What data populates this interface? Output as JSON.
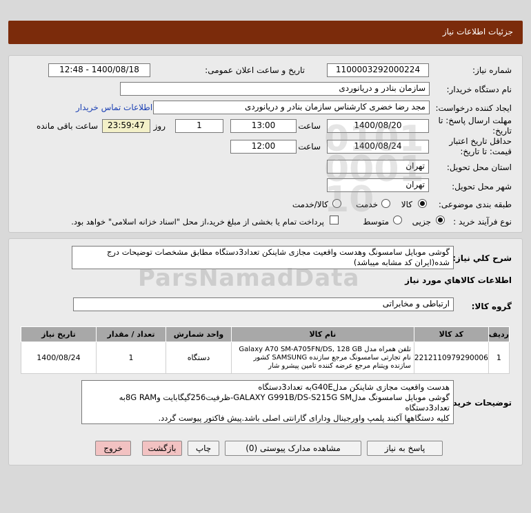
{
  "header": {
    "title": "جزئیات اطلاعات نیاز"
  },
  "form": {
    "need_number_label": "شماره نیاز:",
    "need_number": "1100003292000224",
    "announce_label": "تاریخ و ساعت اعلان عمومی:",
    "announce_value": "1400/08/18 - 12:48",
    "buyer_org_label": "نام دستگاه خریدار:",
    "buyer_org": "سازمان بنادر و دریانوردی",
    "requester_label": "ایجاد کننده درخواست:",
    "requester": "مجد رضا خضری کارشناس سازمان بنادر و دریانوردی",
    "contact_link": "اطلاعات تماس خریدار",
    "deadline_label_1": "مهلت ارسال پاسخ: تا",
    "deadline_label_2": "تاریخ:",
    "deadline_date": "1400/08/20",
    "hour_label": "ساعت",
    "deadline_hour": "13:00",
    "deadline_days": "1",
    "days_label": "روز و",
    "remaining_time": "23:59:47",
    "remaining_label": "ساعت باقی مانده",
    "validity_label_1": "حداقل تاریخ اعتبار",
    "validity_label_2": "قیمت: تا تاریخ:",
    "validity_date": "1400/08/24",
    "validity_hour_label": "ساعت",
    "validity_hour": "12:00",
    "province_label": "استان محل تحویل:",
    "province": "تهران",
    "city_label": "شهر محل تحویل:",
    "city": "تهران",
    "category_label": "طبقه بندی موضوعی:",
    "category_options": [
      "کالا",
      "خدمت",
      "کالا/خدمت"
    ],
    "category_selected": 0,
    "process_label": "نوع فرآیند خرید :",
    "process_options": [
      "جزیی",
      "متوسط"
    ],
    "process_selected": 0,
    "payment_note": "پرداخت تمام یا بخشی از مبلغ خرید،از محل \"اسناد خزانه اسلامی\" خواهد بود."
  },
  "summary": {
    "label": "شرح کلي نياز:",
    "text": "گوشی موبایل سامسونگ وهدست واقعیت مجازی شاینکن تعداد3دستگاه مطابق مشخصات توضیحات درج شده(ایران کد مشابه میباشد)"
  },
  "goods_section": {
    "title": "اطلاعات کالاهاي مورد نياز",
    "group_label": "گروه کالا:",
    "group_value": "ارتباطی و مخابراتی"
  },
  "table": {
    "headers": [
      "ردیف",
      "کد کالا",
      "نام کالا",
      "واحد شمارش",
      "تعداد / مقدار",
      "تاریخ نیاز"
    ],
    "rows": [
      {
        "index": "1",
        "code": "2212110979290006",
        "name": "تلفن همراه مدل Galaxy A70 SM-A705FN/DS, 128 GB نام تجارتی سامسونگ مرجع سازنده SAMSUNG کشور سازنده ویتنام مرجع عرضه کننده تامین پیشرو شار",
        "unit": "دستگاه",
        "qty": "1",
        "date": "1400/08/24"
      }
    ]
  },
  "buyer_notes": {
    "label": "توضیحات خریدار:",
    "lines": [
      "هدست واقعیت مجازی شاینکن مدلG40Eبه تعداد3دستگاه",
      "گوشی موبایل سامسونگ مدلGALAXY G991B/DS-S215G SM-ظرفیت256گیگابایت و8G RAMبه",
      "تعداد3دستگاه",
      "کلیه دستگاهها آکبند پلمپ واورجینال ودارای گارانتی اصلی باشد.پیش فاکتور پیوست گردد."
    ]
  },
  "buttons": {
    "reply": "پاسخ به نیاز",
    "attachments": "مشاهده مدارک پیوستی (0)",
    "print": "چاپ",
    "back": "بازگشت",
    "exit": "خروج"
  },
  "watermark": {
    "text": "ParsNamadData"
  }
}
